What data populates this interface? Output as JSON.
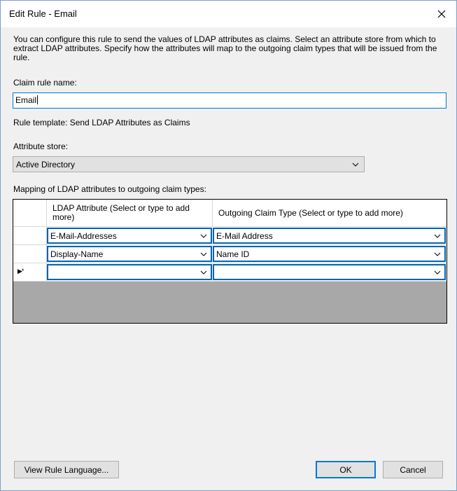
{
  "dialog": {
    "title": "Edit Rule - Email",
    "description": "You can configure this rule to send the values of LDAP attributes as claims. Select an attribute store from which to extract LDAP attributes. Specify how the attributes will map to the outgoing claim types that will be issued from the rule.",
    "claim_rule_name_label": "Claim rule name:",
    "claim_rule_name_value": "Email",
    "rule_template_text": "Rule template: Send LDAP Attributes as Claims",
    "attribute_store_label": "Attribute store:",
    "attribute_store_value": "Active Directory",
    "mapping_label": "Mapping of LDAP attributes to outgoing claim types:"
  },
  "mapping_grid": {
    "columns": [
      "LDAP Attribute (Select or type to add more)",
      "Outgoing Claim Type (Select or type to add more)"
    ],
    "rows": [
      {
        "ldap_attribute": "E-Mail-Addresses",
        "claim_type": "E-Mail Address"
      },
      {
        "ldap_attribute": "Display-Name",
        "claim_type": "Name ID"
      },
      {
        "ldap_attribute": "",
        "claim_type": ""
      }
    ],
    "new_row_marker": "▶*"
  },
  "buttons": {
    "view_rule_language": "View Rule Language...",
    "ok": "OK",
    "cancel": "Cancel"
  },
  "colors": {
    "focus_border": "#0078d7",
    "window_bg": "#f0f0f0",
    "grid_bg": "#a8a8a8"
  },
  "icons": {
    "close": "close-icon",
    "dropdown": "chevron-down-icon"
  }
}
